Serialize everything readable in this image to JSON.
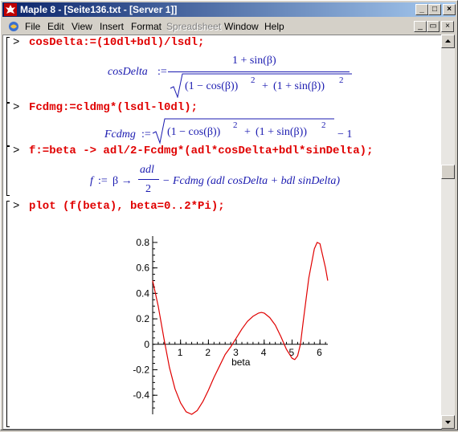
{
  "window": {
    "title": "Maple 8 - [Seite136.txt - [Server 1]]",
    "controls": [
      "_",
      "□",
      "×"
    ],
    "doc_controls": [
      "_",
      "▭",
      "×"
    ]
  },
  "menu": {
    "items": [
      "File",
      "Edit",
      "View",
      "Insert",
      "Format",
      "Spreadsheet",
      "Window",
      "Help"
    ],
    "disabled": [
      "Spreadsheet"
    ]
  },
  "worksheet": {
    "prompt": ">",
    "cmd1": "cosDelta:=(10dl+bdl)/lsdl;",
    "out1": {
      "lhs": "cosDelta",
      "assign": ":=",
      "numerator": "1 + sin(β)",
      "denominator_a": "(1 − cos(β))",
      "exp": "2",
      "plus": "+",
      "denominator_b": "(1 + sin(β))"
    },
    "cmd2": "Fcdmg:=cldmg*(lsdl-l0dl);",
    "out2": {
      "lhs": "Fcdmg",
      "assign": ":=",
      "rad_a": "(1 − cos(β))",
      "exp": "2",
      "plus": "+",
      "rad_b": "(1 + sin(β))",
      "tail": "− 1"
    },
    "cmd3": "f:=beta -> adl/2-Fcdmg*(adl*cosDelta+bdl*sinDelta);",
    "out3": {
      "lhs": "f",
      "assign": ":=",
      "arrow": "β →",
      "frac_num": "adl",
      "frac_den": "2",
      "rest": "− Fcdmg (adl cosDelta + bdl sinDelta)"
    },
    "cmd4": "plot (f(beta), beta=0..2*Pi);"
  },
  "chart_data": {
    "type": "line",
    "xlabel": "beta",
    "ylabel": "",
    "xlim": [
      0,
      6.2832
    ],
    "ylim": [
      -0.55,
      0.85
    ],
    "xticks": [
      1,
      2,
      3,
      4,
      5,
      6
    ],
    "yticks": [
      -0.4,
      -0.2,
      0.2,
      0.4,
      0.6,
      0.8
    ],
    "ytick_labels": [
      "-0.4",
      "-0.2",
      "0.2",
      "0.4",
      "0.6",
      "0.8"
    ],
    "origin_label": "0",
    "line_color": "#e00000",
    "series": [
      {
        "x": [
          0,
          0.2,
          0.4,
          0.6,
          0.8,
          1.0,
          1.2,
          1.4,
          1.6,
          1.8,
          2.0,
          2.2,
          2.4,
          2.6,
          2.8,
          3.0,
          3.2,
          3.4,
          3.6,
          3.8,
          3.9,
          4.0,
          4.2,
          4.4,
          4.6,
          4.8,
          5.0,
          5.1,
          5.2,
          5.3,
          5.4,
          5.6,
          5.8,
          5.9,
          6.0,
          6.2,
          6.28
        ],
        "y": [
          0.5,
          0.3,
          0.05,
          -0.18,
          -0.35,
          -0.46,
          -0.53,
          -0.55,
          -0.52,
          -0.45,
          -0.36,
          -0.26,
          -0.17,
          -0.08,
          -0.02,
          0.05,
          0.12,
          0.18,
          0.22,
          0.245,
          0.25,
          0.245,
          0.21,
          0.15,
          0.06,
          -0.04,
          -0.11,
          -0.12,
          -0.09,
          0.0,
          0.18,
          0.52,
          0.75,
          0.8,
          0.79,
          0.6,
          0.5
        ]
      }
    ]
  }
}
